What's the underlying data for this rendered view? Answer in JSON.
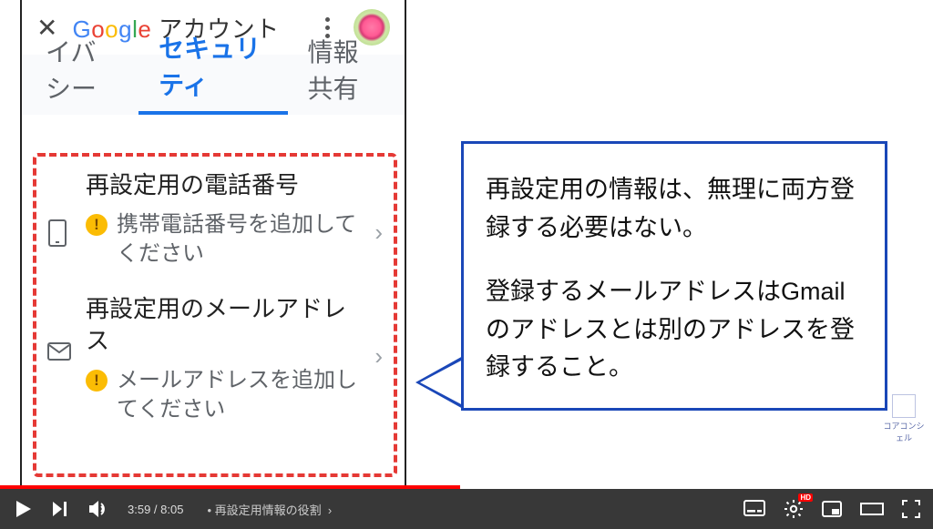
{
  "header": {
    "title_prefix": "Google",
    "title_suffix": " アカウント"
  },
  "tabs": {
    "privacy": "イバシー",
    "security": "セキュリティ",
    "sharing": "情報共有"
  },
  "recovery": {
    "phone": {
      "title": "再設定用の電話番号",
      "help": "携帯電話番号を追加してください"
    },
    "email": {
      "title": "再設定用のメールアドレス",
      "help": "メールアドレスを追加してください"
    }
  },
  "speech": {
    "p1": "再設定用の情報は、無理に両方登録する必要はない。",
    "p2": "登録するメールアドレスはGmailのアドレスとは別のアドレスを登録すること。"
  },
  "brand": "コアコンシェル",
  "player": {
    "current": "3:59",
    "total": "8:05",
    "chapter": "再設定用情報の役割",
    "sep": " / ",
    "dot": " • ",
    "playedPct": 49.3,
    "bufferedPct": 52
  }
}
